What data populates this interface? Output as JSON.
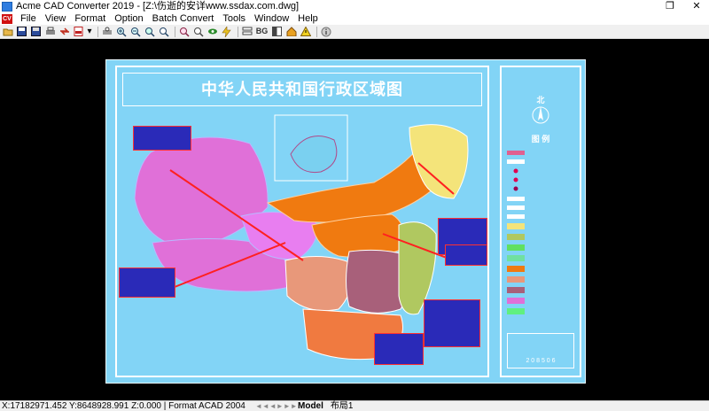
{
  "window": {
    "title": "Acme CAD Converter 2019 - [Z:\\伤逝的安详www.ssdax.com.dwg]",
    "controls": [
      "❐",
      "✕"
    ]
  },
  "menu": {
    "logo_text": "CV",
    "items": [
      "File",
      "View",
      "Format",
      "Option",
      "Batch Convert",
      "Tools",
      "Window",
      "Help"
    ]
  },
  "toolbar": {
    "bg_label": "BG"
  },
  "drawing": {
    "map_title": "中华人民共和国行政区域图",
    "legend_north": "北",
    "legend_title": "图  例",
    "legend_code": "2 0 8 5 0 6"
  },
  "status": {
    "coords": "X:17182971.452 Y:8648928.991 Z:0.000 | Format ACAD 2004",
    "nav": [
      "◄◄",
      "◄",
      "►",
      "►►"
    ],
    "tabs": [
      "Model",
      "布局1"
    ]
  },
  "colors": {
    "drawing_bg": "#82d4f6",
    "workspace_bg": "#000000"
  }
}
